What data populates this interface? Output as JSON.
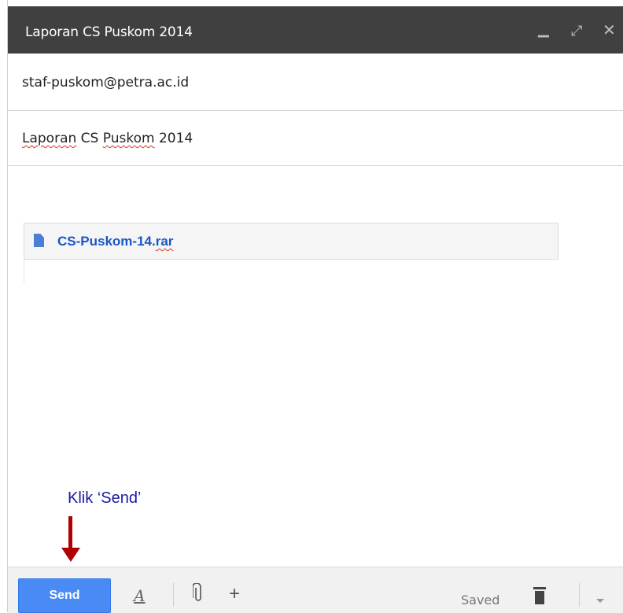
{
  "window": {
    "title": "Laporan CS Puskom 2014",
    "controls": {
      "minimize": "▁",
      "expand": "⤢",
      "close": "✕"
    }
  },
  "to": {
    "value": "staf-puskom@petra.ac.id"
  },
  "subject": {
    "word1": "Laporan",
    "word2": "CS",
    "word3": "Puskom",
    "word4": "2014"
  },
  "attachment": {
    "name_main": "CS-Puskom-14.",
    "name_ext": "rar",
    "icon": "file-icon"
  },
  "annotation": {
    "text": "Klik ‘Send’",
    "color": "#1a1aa3",
    "arrow_color": "#b00000"
  },
  "toolbar": {
    "send_label": "Send",
    "format_label": "A",
    "insert_label": "+",
    "status": "Saved",
    "send_color": "#4a8af4"
  }
}
